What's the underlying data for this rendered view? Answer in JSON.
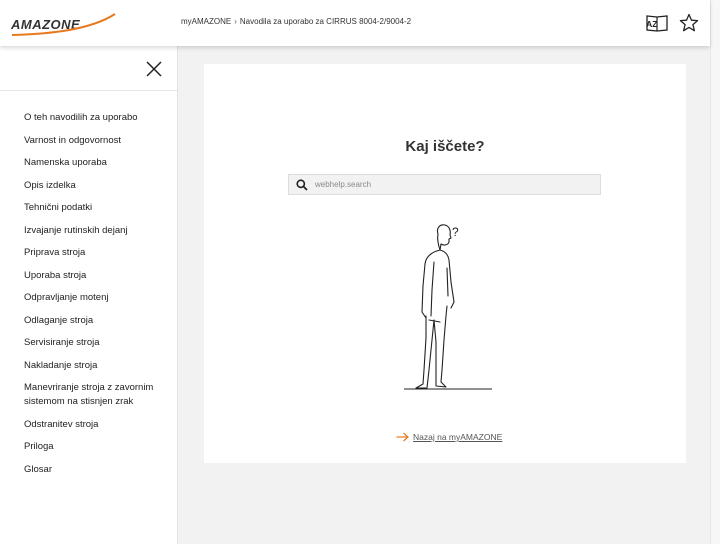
{
  "header": {
    "logo_text": "AMAZONE",
    "breadcrumb": [
      "myAMAZONE",
      "Navodila za uporabo za CIRRUS 8004-2/9004-2"
    ],
    "breadcrumb_sep": "›",
    "glossary_icon_text": "AZ"
  },
  "sidebar": {
    "items": [
      "O teh navodilih za uporabo",
      "Varnost in odgovornost",
      "Namenska uporaba",
      "Opis izdelka",
      "Tehnični podatki",
      "Izvajanje rutinskih dejanj",
      "Priprava stroja",
      "Uporaba stroja",
      "Odpravljanje motenj",
      "Odlaganje stroja",
      "Servisiranje stroja",
      "Nakladanje stroja",
      "Manevriranje stroja z zavornim sistemom na stisnjen zrak",
      "Odstranitev stroja",
      "Priloga",
      "Glosar"
    ]
  },
  "content": {
    "title": "Kaj iščete?",
    "search_placeholder": "webhelp.search",
    "question_mark": "?",
    "back_link": "Nazaj na myAMAZONE"
  },
  "colors": {
    "accent": "#e8791d",
    "text": "#222222",
    "background": "#f2f2f2"
  }
}
